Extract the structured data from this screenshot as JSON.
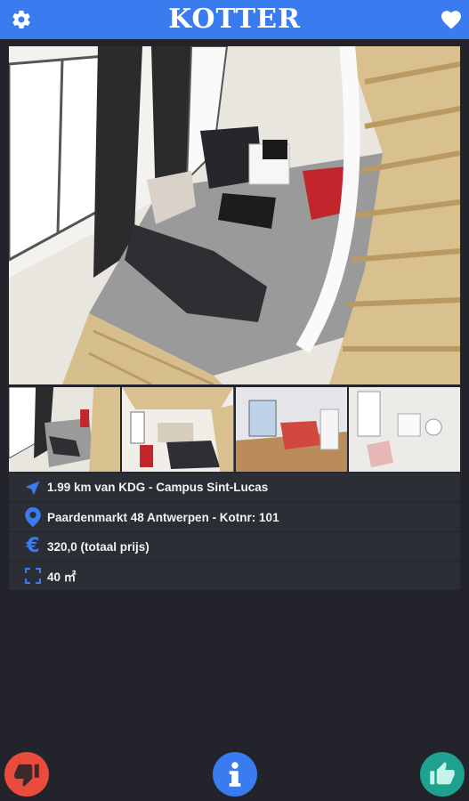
{
  "app": {
    "title": "KOTTER"
  },
  "icons": {
    "settings": "gear-icon",
    "favorite": "heart-icon",
    "distance": "navigation-arrow-icon",
    "address": "location-pin-icon",
    "price": "euro-icon",
    "size": "area-frame-icon",
    "dislike": "thumbs-down-icon",
    "info": "info-icon",
    "like": "thumbs-up-icon"
  },
  "details": {
    "distance": "1.99 km van KDG - Campus Sint-Lucas",
    "address": "Paardenmarkt 48 Antwerpen - Kotnr: 101",
    "price_symbol": "€",
    "price": "320,0 (totaal prijs)",
    "size": "40 ㎡"
  },
  "colors": {
    "accent": "#3a7bf0",
    "background": "#23242b",
    "panel": "#2c2e35",
    "dislike": "#e94b3c",
    "like": "#1ea28f"
  }
}
